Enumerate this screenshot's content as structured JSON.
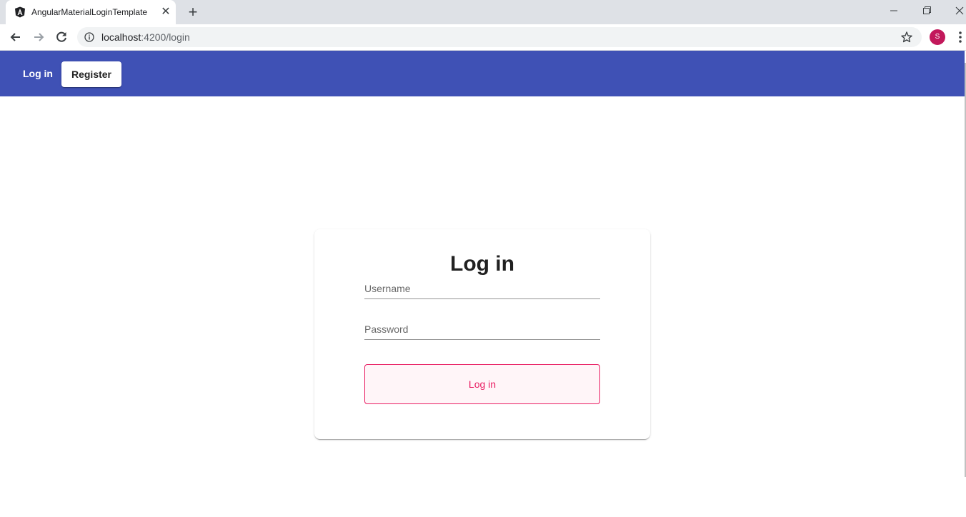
{
  "browser": {
    "tab_title": "AngularMaterialLoginTemplate",
    "tab_close": "✕",
    "new_tab": "+",
    "url_host": "localhost",
    "url_path": ":4200/login",
    "profile_initial": "S"
  },
  "header": {
    "login_label": "Log in",
    "register_label": "Register"
  },
  "login_card": {
    "title": "Log in",
    "username_placeholder": "Username",
    "password_placeholder": "Password",
    "submit_label": "Log in"
  },
  "colors": {
    "appbar": "#3f51b5",
    "accent": "#e91e63",
    "avatar": "#c2185b"
  }
}
